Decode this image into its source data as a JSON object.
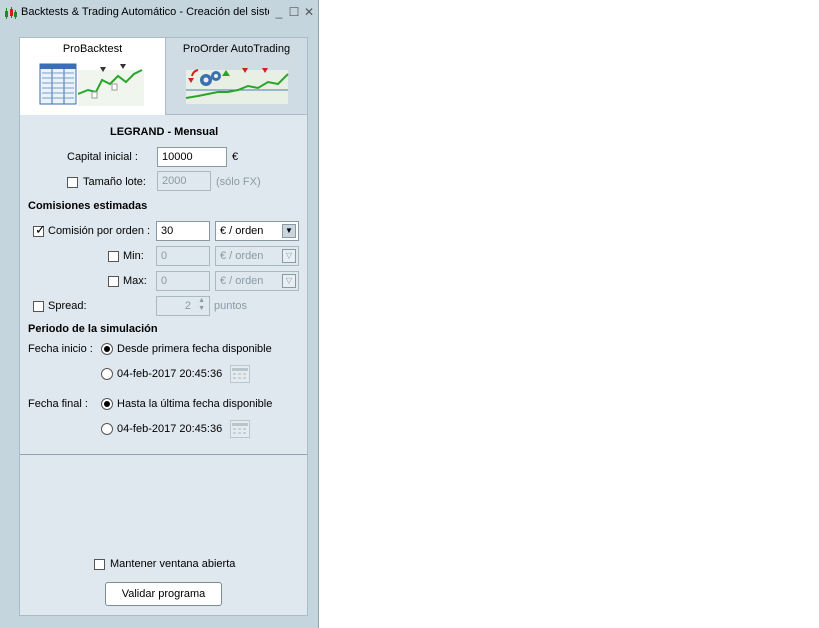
{
  "window": {
    "title": "Backtests & Trading Automático - Creación del siste"
  },
  "tabs": [
    {
      "label": "ProBacktest"
    },
    {
      "label": "ProOrder AutoTrading"
    }
  ],
  "form": {
    "heading": "LEGRAND - Mensual",
    "capital_label": "Capital inicial :",
    "capital_value": "10000",
    "capital_unit": "€",
    "lot_label": "Tamaño lote:",
    "lot_value": "2000",
    "lot_hint": "(sólo FX)",
    "commissions_heading": "Comisiones estimadas",
    "commission_label": "Comisión por orden :",
    "commission_value": "30",
    "commission_unit": "€ / orden",
    "min_label": "Min:",
    "min_value": "0",
    "min_unit": "€ / orden",
    "max_label": "Max:",
    "max_value": "0",
    "max_unit": "€ / orden",
    "spread_label": "Spread:",
    "spread_value": "2",
    "spread_unit": "puntos",
    "period_heading": "Periodo de la simulación",
    "start_label": "Fecha inicio :",
    "start_option_1": "Desde primera fecha disponible",
    "start_option_2": "04-feb-2017 20:45:36",
    "end_label": "Fecha final :",
    "end_option_1": "Hasta la última fecha disponible",
    "end_option_2": "04-feb-2017 20:45:36"
  },
  "footer": {
    "keep_open_label": "Mantener ventana abierta",
    "validate_label": "Validar programa"
  },
  "state": {
    "lot_checked": false,
    "commission_checked": true,
    "min_checked": false,
    "max_checked": false,
    "spread_checked": false,
    "start_selected": 1,
    "end_selected": 1,
    "keep_open_checked": false
  }
}
